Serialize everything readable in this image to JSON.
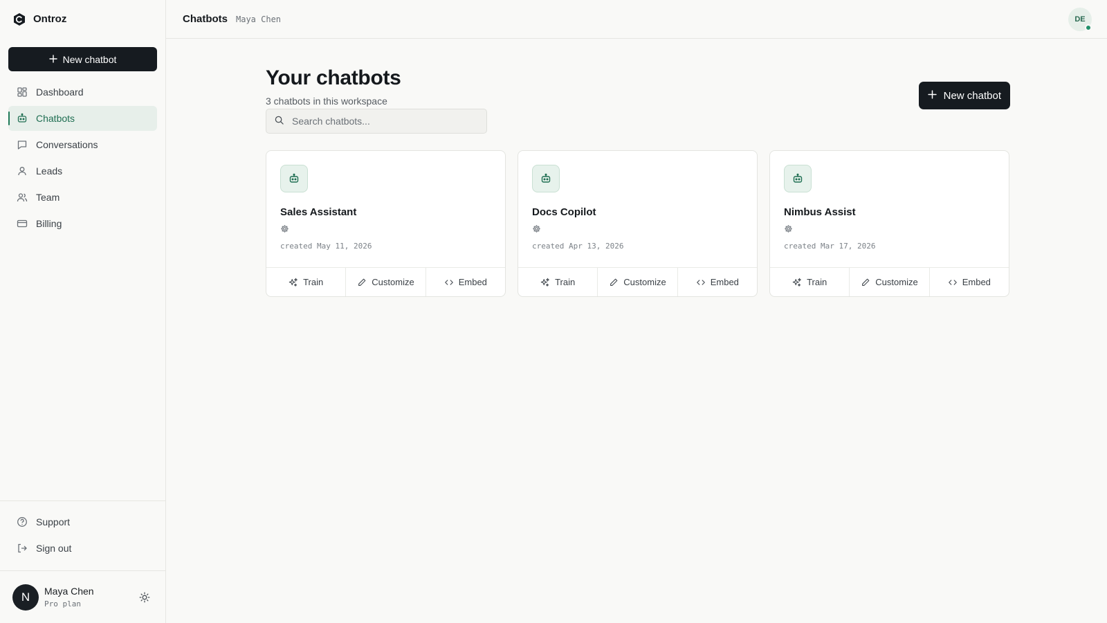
{
  "brand": {
    "name": "Ontroz"
  },
  "sidebar": {
    "new_button_label": "New chatbot",
    "items": [
      {
        "label": "Dashboard",
        "icon": "grid-icon"
      },
      {
        "label": "Chatbots",
        "icon": "bot-icon",
        "active": true
      },
      {
        "label": "Conversations",
        "icon": "message-icon"
      },
      {
        "label": "Leads",
        "icon": "user-icon"
      },
      {
        "label": "Team",
        "icon": "users-icon"
      },
      {
        "label": "Billing",
        "icon": "card-icon"
      }
    ],
    "bottom_links": [
      {
        "label": "Support",
        "icon": "help-circle-icon"
      },
      {
        "label": "Sign out",
        "icon": "log-out-icon"
      }
    ],
    "user": {
      "initial": "N",
      "name": "Maya Chen",
      "plan": "Pro plan"
    }
  },
  "topbar": {
    "title": "Chatbots",
    "subtitle": "Maya Chen",
    "avatar_initials": "DE"
  },
  "main": {
    "title": "Your chatbots",
    "subtitle": "3 chatbots in this workspace",
    "new_button_label": "New chatbot",
    "search_placeholder": "Search chatbots...",
    "cards": [
      {
        "name": "Sales Assistant",
        "created": "created May 11, 2026"
      },
      {
        "name": "Docs Copilot",
        "created": "created Apr 13, 2026"
      },
      {
        "name": "Nimbus Assist",
        "created": "created Mar 17, 2026"
      }
    ],
    "actions": {
      "train": "Train",
      "customize": "Customize",
      "embed": "Embed"
    }
  },
  "colors": {
    "accent": "#1f6e52",
    "dark": "#161b20",
    "status_online": "#21906a"
  }
}
